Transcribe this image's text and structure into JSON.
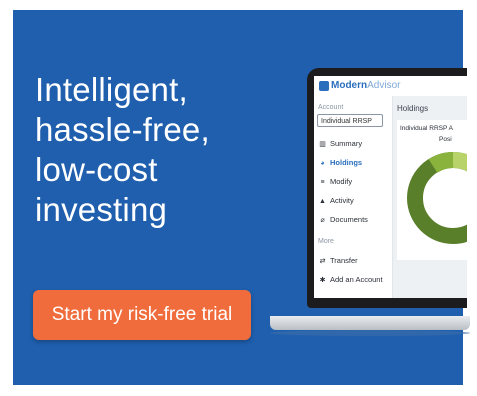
{
  "ad": {
    "background": "#1f5fae",
    "headline": [
      "Intelligent,",
      "hassle-free,",
      "low-cost",
      "investing"
    ],
    "cta": {
      "label": "Start my risk-free trial",
      "color": "#f06c3c"
    }
  },
  "app": {
    "brand_bold": "Modern",
    "brand_light": "Advisor",
    "account_label": "Account",
    "account_value": "Individual RRSP",
    "nav": [
      {
        "label": "Summary",
        "icon": "bar-chart-icon",
        "glyph": "▥"
      },
      {
        "label": "Holdings",
        "icon": "pie-chart-icon",
        "glyph": "◕",
        "active": true
      },
      {
        "label": "Modify",
        "icon": "sliders-icon",
        "glyph": "≡"
      },
      {
        "label": "Activity",
        "icon": "bell-icon",
        "glyph": "▲"
      },
      {
        "label": "Documents",
        "icon": "attachment-icon",
        "glyph": "⌀"
      }
    ],
    "more_label": "More",
    "more_nav": [
      {
        "label": "Transfer",
        "icon": "transfer-icon",
        "glyph": "⇄"
      },
      {
        "label": "Add an Account",
        "icon": "asterisk-icon",
        "glyph": "✱"
      }
    ],
    "main_title": "Holdings",
    "card_title": "Individual RRSP A",
    "card_sub": "Posi",
    "donut_colors": [
      "#5a7f2a",
      "#8ab33d",
      "#2f4a1a",
      "#b8d36a"
    ]
  }
}
